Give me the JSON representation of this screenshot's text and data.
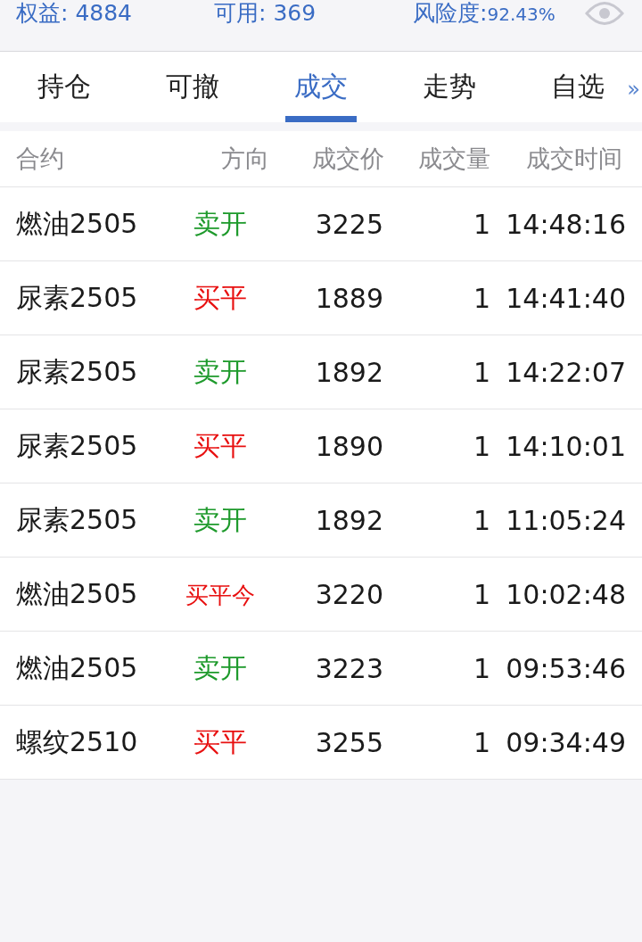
{
  "summary": [
    {
      "label": "权益: ",
      "value": "4884"
    },
    {
      "label": "可用: ",
      "value": "369"
    },
    {
      "label": "风险度:",
      "value": "92.43%"
    }
  ],
  "tabs": [
    {
      "label": "持仓",
      "selected": false
    },
    {
      "label": "可撤",
      "selected": false
    },
    {
      "label": "成交",
      "selected": true
    },
    {
      "label": "走势",
      "selected": false
    },
    {
      "label": "自选",
      "selected": false
    }
  ],
  "more": "»",
  "table": {
    "columns": [
      "合约",
      "方向",
      "成交价",
      "成交量",
      "成交时间"
    ],
    "rows": [
      {
        "contract": "燃油2505",
        "direction": "卖开",
        "kind": "sell",
        "price": "3225",
        "qty": "1",
        "time": "14:48:16"
      },
      {
        "contract": "尿素2505",
        "direction": "买平",
        "kind": "buy",
        "price": "1889",
        "qty": "1",
        "time": "14:41:40"
      },
      {
        "contract": "尿素2505",
        "direction": "卖开",
        "kind": "sell",
        "price": "1892",
        "qty": "1",
        "time": "14:22:07"
      },
      {
        "contract": "尿素2505",
        "direction": "买平",
        "kind": "buy",
        "price": "1890",
        "qty": "1",
        "time": "14:10:01"
      },
      {
        "contract": "尿素2505",
        "direction": "卖开",
        "kind": "sell",
        "price": "1892",
        "qty": "1",
        "time": "11:05:24"
      },
      {
        "contract": "燃油2505",
        "direction": "买平今",
        "kind": "buy",
        "price": "3220",
        "qty": "1",
        "time": "10:02:48"
      },
      {
        "contract": "燃油2505",
        "direction": "卖开",
        "kind": "sell",
        "price": "3223",
        "qty": "1",
        "time": "09:53:46"
      },
      {
        "contract": "螺纹2510",
        "direction": "买平",
        "kind": "buy",
        "price": "3255",
        "qty": "1",
        "time": "09:34:49"
      }
    ]
  }
}
